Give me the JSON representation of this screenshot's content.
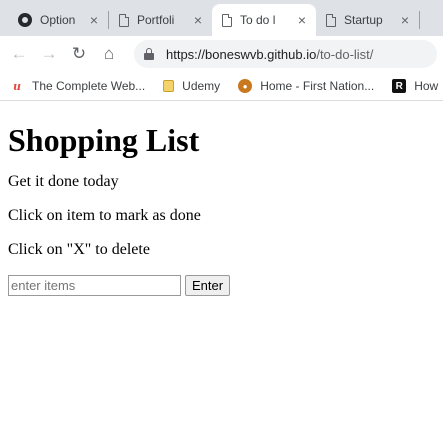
{
  "browser": {
    "tabs": [
      {
        "title": "Option",
        "favicon": "github-icon"
      },
      {
        "title": "Portfoli",
        "favicon": "document-icon"
      },
      {
        "title": "To do l",
        "favicon": "document-icon",
        "active": true
      },
      {
        "title": "Startup",
        "favicon": "document-icon"
      }
    ],
    "close_glyph": "×",
    "address": {
      "host": "https://boneswvb.github.io",
      "path": "/to-do-list/"
    },
    "bookmarks": [
      {
        "label": "The Complete Web...",
        "icon": "udemy-logo-icon"
      },
      {
        "label": "Udemy",
        "icon": "folder-icon"
      },
      {
        "label": "Home - First Nation...",
        "icon": "first-nation-icon"
      },
      {
        "label": "How",
        "icon": "bookmark-r-icon"
      }
    ]
  },
  "page": {
    "title": "Shopping List",
    "lines": [
      "Get it done today",
      "Click on item to mark as done",
      "Click on \"X\" to delete"
    ],
    "input_placeholder": "enter items",
    "enter_label": "Enter"
  }
}
